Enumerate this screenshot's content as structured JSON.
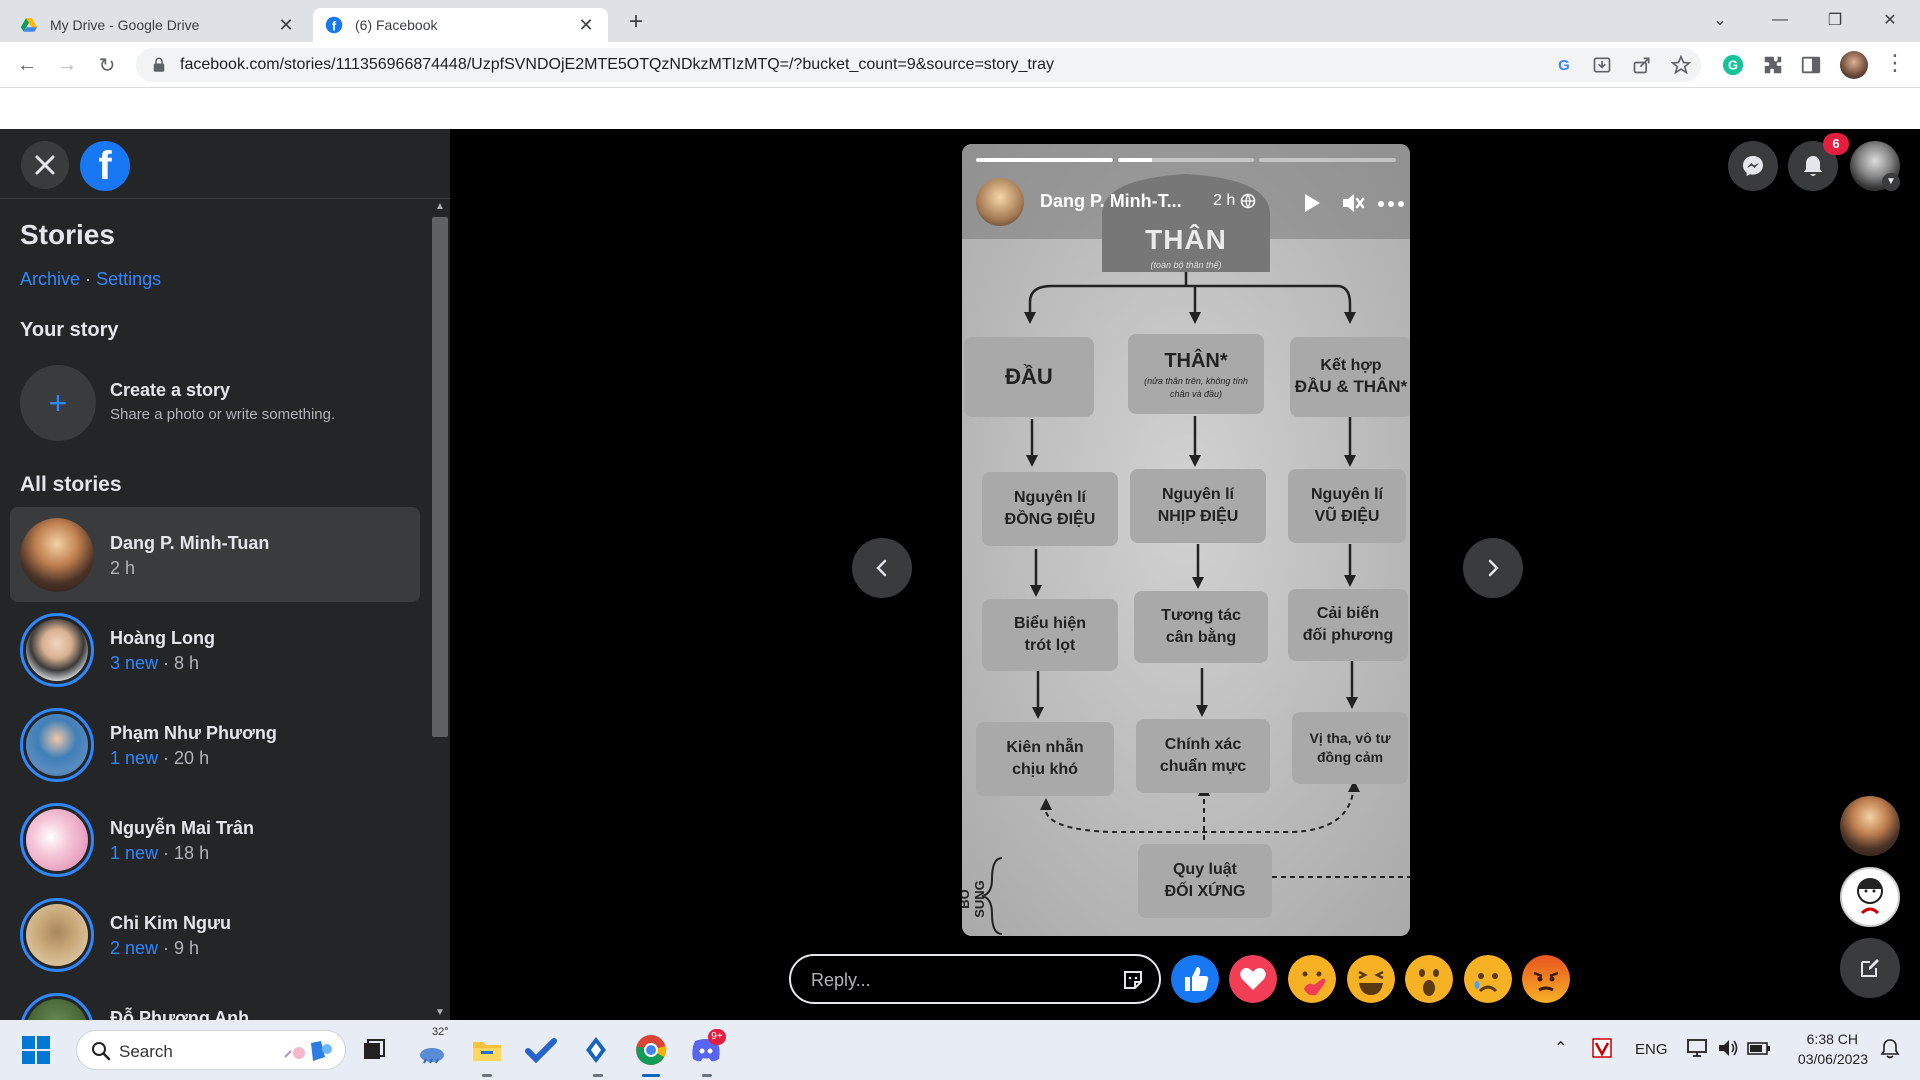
{
  "browser": {
    "tabs": [
      {
        "title": "My Drive - Google Drive",
        "active": false
      },
      {
        "title": "(6) Facebook",
        "active": true
      }
    ],
    "url": "facebook.com/stories/111356966874448/UzpfSVNDOjE2MTE5OTQzNDkzMTIzMTQ=/?bucket_count=9&source=story_tray"
  },
  "sidebar": {
    "title": "Stories",
    "archive_label": "Archive",
    "settings_label": "Settings",
    "separator": "·",
    "your_story_heading": "Your story",
    "create_title": "Create a story",
    "create_subtitle": "Share a photo or write something.",
    "all_stories_heading": "All stories",
    "stories": [
      {
        "name": "Dang P. Minh-Tuan",
        "new_count": "",
        "time": "2 h",
        "selected": true
      },
      {
        "name": "Hoàng Long",
        "new_count": "3 new",
        "time": "8 h",
        "selected": false
      },
      {
        "name": "Phạm Như Phương",
        "new_count": "1 new",
        "time": "20 h",
        "selected": false
      },
      {
        "name": "Nguyễn Mai Trân",
        "new_count": "1 new",
        "time": "18 h",
        "selected": false
      },
      {
        "name": "Chi Kim Ngưu",
        "new_count": "2 new",
        "time": "9 h",
        "selected": false
      },
      {
        "name": "Đỗ Phương Anh",
        "new_count": "",
        "time": "",
        "selected": false
      }
    ]
  },
  "viewer": {
    "author": "Dang P. Minh-T...",
    "time": "2 h",
    "progress": [
      1.0,
      0.25,
      0.0
    ],
    "reply_placeholder": "Reply...",
    "notification_count": "6",
    "reactions": [
      "like",
      "love",
      "care",
      "haha",
      "wow",
      "sad",
      "angry"
    ]
  },
  "story_image": {
    "top_title": "THÂN",
    "top_subtitle": "(toàn bộ thân thể)",
    "col1_head": "ĐẦU",
    "col2_head": "THÂN*",
    "col2_note": "(nửa thân trên, không tính chân và đầu)",
    "col3_head_line1": "Kết hợp",
    "col3_head_line2": "ĐẦU & THÂN*",
    "row1": [
      [
        "Nguyên lí",
        "ĐỒNG ĐIỆU"
      ],
      [
        "Nguyên lí",
        "NHỊP ĐIỆU"
      ],
      [
        "Nguyên lí",
        "VŨ ĐIỆU"
      ]
    ],
    "row2": [
      [
        "Biểu hiện",
        "trót lọt"
      ],
      [
        "Tương tác",
        "cân bằng"
      ],
      [
        "Cải biến",
        "đối phương"
      ]
    ],
    "row3": [
      [
        "Kiên nhẫn",
        "chịu khó"
      ],
      [
        "Chính xác",
        "chuẩn mực"
      ],
      [
        "Vị tha, vô tư",
        "đồng cảm"
      ]
    ],
    "bottom_line1": "Quy luật",
    "bottom_line2": "ĐỐI XỨNG",
    "side_label": "BỔ SUNG"
  },
  "taskbar": {
    "search_label": "Search",
    "weather_temp": "32°",
    "language": "ENG",
    "time": "6:38 CH",
    "date": "03/06/2023",
    "discord_badge": "9+"
  },
  "colors": {
    "facebook_blue": "#1877f2",
    "panel_bg": "#242526",
    "link_blue": "#2d88ff",
    "notif_red": "#e41e3f"
  }
}
